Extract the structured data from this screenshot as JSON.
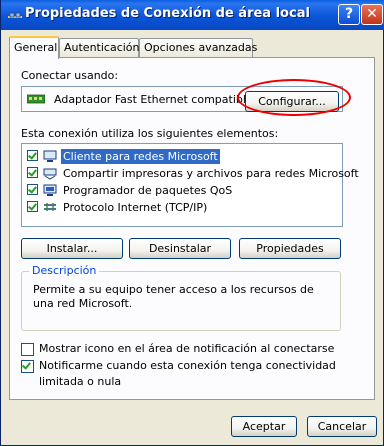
{
  "window": {
    "title": "Propiedades de Conexión de área local",
    "help_label": "?",
    "close_label": "✕"
  },
  "tabs": [
    {
      "label": "General"
    },
    {
      "label": "Autenticación"
    },
    {
      "label": "Opciones avanzadas"
    }
  ],
  "connect_using": {
    "label": "Conectar usando:",
    "adapter": "Adaptador Fast Ethernet compatible",
    "configure_button": "Configurar..."
  },
  "components": {
    "label": "Esta conexión utiliza los siguientes elementos:",
    "items": [
      {
        "label": "Cliente para redes Microsoft",
        "checked": true,
        "selected": true,
        "icon": "network-client-icon"
      },
      {
        "label": "Compartir impresoras y archivos para redes Microsoft",
        "checked": true,
        "icon": "printer-share-icon"
      },
      {
        "label": "Programador de paquetes QoS",
        "checked": true,
        "icon": "qos-icon"
      },
      {
        "label": "Protocolo Internet (TCP/IP)",
        "checked": true,
        "icon": "protocol-icon"
      }
    ],
    "install_button": "Instalar...",
    "uninstall_button": "Desinstalar",
    "properties_button": "Propiedades"
  },
  "description": {
    "legend": "Descripción",
    "text": "Permite a su equipo tener acceso a los recursos de una red Microsoft."
  },
  "options": [
    {
      "label": "Mostrar icono en el área de notificación al conectarse",
      "checked": false
    },
    {
      "label": "Notificarme cuando esta conexión tenga conectividad limitada o nula",
      "checked": true
    }
  ],
  "footer": {
    "accept_button": "Aceptar",
    "cancel_button": "Cancelar"
  },
  "colors": {
    "title_bar": "#0a55d8",
    "selection": "#316ac5",
    "highlight_circle": "#e00000",
    "legend_text": "#0046d5"
  }
}
